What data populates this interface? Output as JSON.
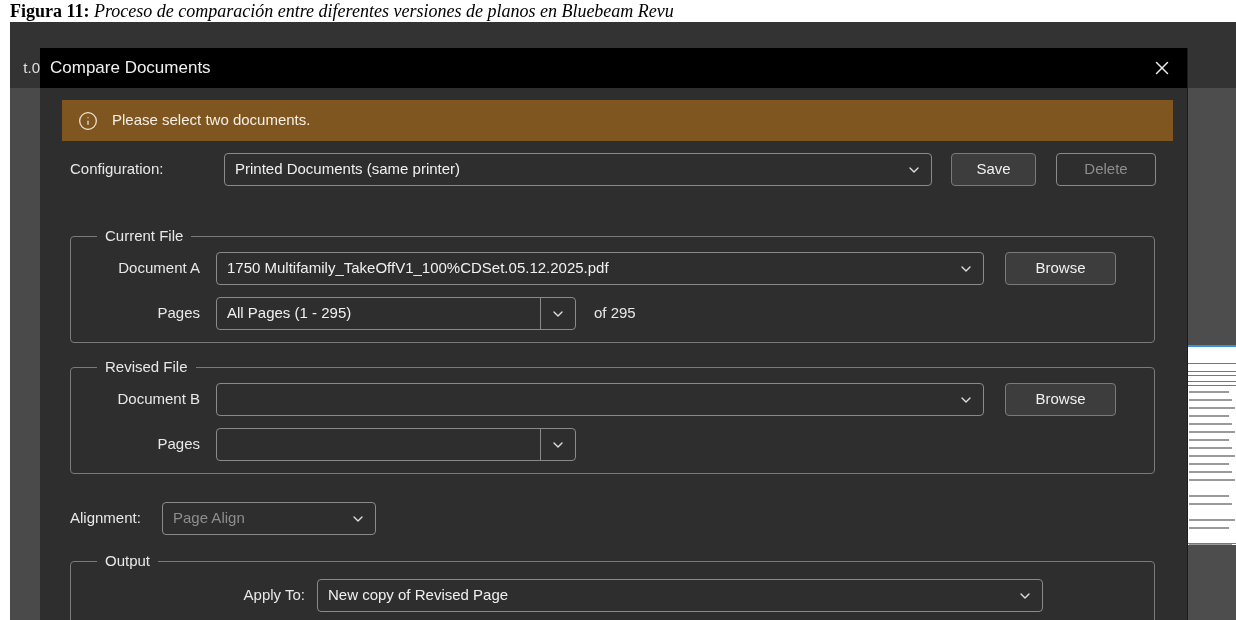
{
  "caption": "**Figura 11:** *Proceso de comparación entre diferentes versiones de planos en Bluebeam Revu*",
  "background_tab": "t.0",
  "dialog": {
    "title": "Compare Documents",
    "notice": "Please select two documents.",
    "configuration": {
      "label": "Configuration:",
      "value": "Printed Documents (same printer)"
    },
    "buttons": [
      {
        "label": "Save",
        "disabled": false
      },
      {
        "label": "Delete",
        "disabled": true
      }
    ],
    "groups": [
      {
        "title": "Current File",
        "document": {
          "label": "Document A",
          "value": "1750 Multifamily_TakeOffV1_100%CDSet.05.12.2025.pdf",
          "browse": "Browse"
        },
        "pages": {
          "label": "Pages",
          "value": "All Pages (1 - 295)",
          "count": "of 295"
        }
      },
      {
        "title": "Revised File",
        "document": {
          "label": "Document B",
          "browse": "Browse"
        },
        "pages": {
          "label": "Pages"
        }
      }
    ],
    "alignment": {
      "label": "Alignment:",
      "value": "Page Align",
      "disabled": true
    },
    "output": {
      "title": "Output",
      "apply_to": {
        "label": "Apply To:",
        "value": "New copy of Revised Page"
      }
    }
  }
}
